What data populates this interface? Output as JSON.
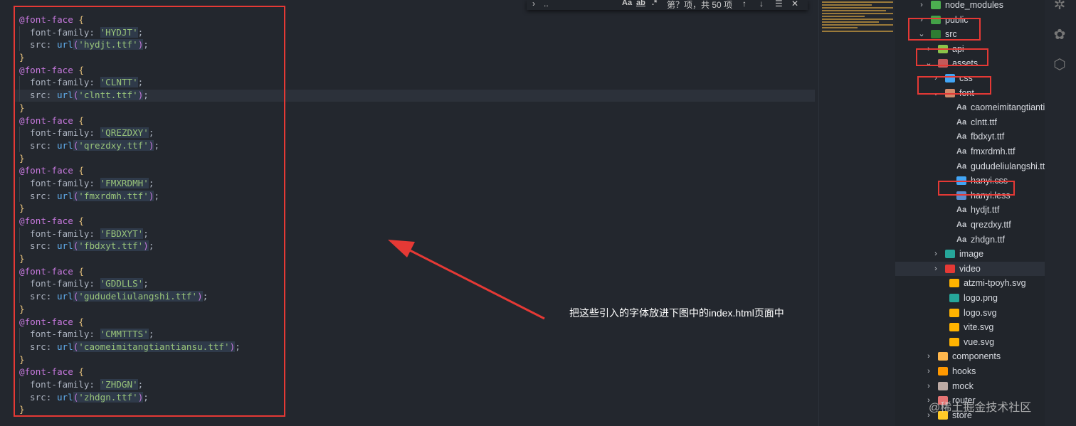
{
  "find": {
    "query": "..",
    "opt_case": "Aa",
    "opt_word": "ab",
    "opt_regex": ".*",
    "result": "第？项，共 50 项"
  },
  "code": [
    {
      "name": "HYDJT",
      "file": "hydjt.ttf"
    },
    {
      "name": "CLNTT",
      "file": "clntt.ttf"
    },
    {
      "name": "QREZDXY",
      "file": "qrezdxy.ttf"
    },
    {
      "name": "FMXRDMH",
      "file": "fmxrdmh.ttf"
    },
    {
      "name": "FBDXYT",
      "file": "fbdxyt.ttf"
    },
    {
      "name": "GDDLLS",
      "file": "gududeliulangshi.ttf"
    },
    {
      "name": "CMMTTTS",
      "file": "caomeimitangtiantiansu.ttf"
    },
    {
      "name": "ZHDGN",
      "file": "zhdgn.ttf"
    }
  ],
  "syntax": {
    "at_rule": "@font-face",
    "open": "{",
    "close": "}",
    "family_prop": "font-family:",
    "src_prop": "src:",
    "url_fn": "url",
    "semi": ";"
  },
  "annotation": "把这些引入的字体放进下图中的index.html页面中",
  "tree": [
    {
      "label": "node_modules",
      "kind": "folder",
      "color": "#4caf50",
      "indent": 1,
      "chev": "›"
    },
    {
      "label": "public",
      "kind": "folder",
      "color": "#43a047",
      "indent": 1,
      "chev": "›"
    },
    {
      "label": "src",
      "kind": "folder",
      "color": "#2e7d32",
      "indent": 1,
      "chev": "⌄"
    },
    {
      "label": "api",
      "kind": "folder",
      "color": "#8bc34a",
      "indent": 2,
      "chev": "›"
    },
    {
      "label": "assets",
      "kind": "folder",
      "color": "#c45a5a",
      "indent": 2,
      "chev": "⌄"
    },
    {
      "label": "css",
      "kind": "folder",
      "color": "#42a5f5",
      "indent": 3,
      "chev": "›"
    },
    {
      "label": "font",
      "kind": "folder",
      "color": "#d08a6a",
      "indent": 3,
      "chev": "⌄"
    },
    {
      "label": "caomeimitangtiantia...",
      "kind": "font",
      "indent": 4
    },
    {
      "label": "clntt.ttf",
      "kind": "font",
      "indent": 4
    },
    {
      "label": "fbdxyt.ttf",
      "kind": "font",
      "indent": 4
    },
    {
      "label": "fmxrdmh.ttf",
      "kind": "font",
      "indent": 4
    },
    {
      "label": "gududeliulangshi.ttf",
      "kind": "font",
      "indent": 4
    },
    {
      "label": "hanyi.css",
      "kind": "css",
      "indent": 4
    },
    {
      "label": "hanyi.less",
      "kind": "less",
      "indent": 4
    },
    {
      "label": "hydjt.ttf",
      "kind": "font",
      "indent": 4
    },
    {
      "label": "qrezdxy.ttf",
      "kind": "font",
      "indent": 4
    },
    {
      "label": "zhdgn.ttf",
      "kind": "font",
      "indent": 4
    },
    {
      "label": "image",
      "kind": "folder",
      "color": "#26a69a",
      "indent": 3,
      "chev": "›"
    },
    {
      "label": "video",
      "kind": "folder",
      "color": "#e53935",
      "indent": 3,
      "chev": "›",
      "selected": true
    },
    {
      "label": "atzmi-tpoyh.svg",
      "kind": "svg",
      "indent": 3
    },
    {
      "label": "logo.png",
      "kind": "img",
      "indent": 3
    },
    {
      "label": "logo.svg",
      "kind": "svg",
      "indent": 3
    },
    {
      "label": "vite.svg",
      "kind": "svg",
      "indent": 3
    },
    {
      "label": "vue.svg",
      "kind": "svg",
      "indent": 3
    },
    {
      "label": "components",
      "kind": "folder",
      "color": "#ffb74d",
      "indent": 2,
      "chev": "›"
    },
    {
      "label": "hooks",
      "kind": "folder",
      "color": "#ff9800",
      "indent": 2,
      "chev": "›"
    },
    {
      "label": "mock",
      "kind": "folder",
      "color": "#bcaaa4",
      "indent": 2,
      "chev": "›"
    },
    {
      "label": "router",
      "kind": "folder",
      "color": "#e57373",
      "indent": 2,
      "chev": "›"
    },
    {
      "label": "store",
      "kind": "folder",
      "color": "#ffca28",
      "indent": 2,
      "chev": "›"
    }
  ],
  "watermark": "@稀土掘金技术社区",
  "colors": {
    "annotation_box": "#e53935",
    "arrow": "#e53935"
  }
}
